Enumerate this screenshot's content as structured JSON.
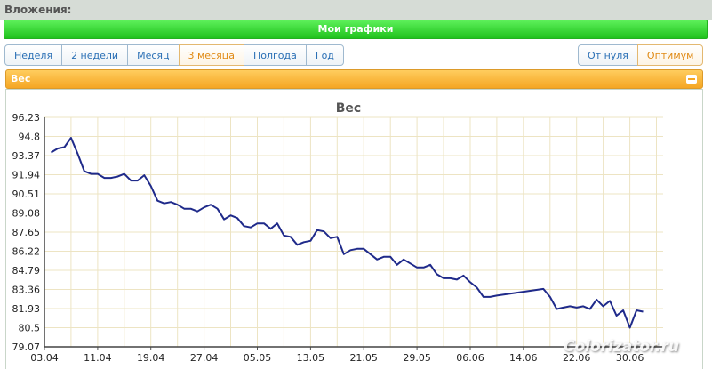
{
  "topbar": {
    "label": "Вложения:"
  },
  "panel": {
    "title": "Мои графики"
  },
  "periods": [
    "Неделя",
    "2 недели",
    "Месяц",
    "3 месяца",
    "Полгода",
    "Год"
  ],
  "period_active": "3 месяца",
  "modes": [
    "От нуля",
    "Оптимум"
  ],
  "mode_active": "Оптимум",
  "chart_header": {
    "title": "Вес"
  },
  "watermark": "Colorizator.ru",
  "colors": {
    "line": "#1f2a8a",
    "grid": "#ede4c3",
    "accent": "#f5a623",
    "brand": "#22c21f"
  },
  "chart_data": {
    "type": "line",
    "title": "Вес",
    "xlabel": "",
    "ylabel": "",
    "y_ticks": [
      "79.07",
      "80.5",
      "81.93",
      "83.36",
      "84.79",
      "86.22",
      "87.65",
      "89.08",
      "90.51",
      "91.94",
      "93.37",
      "94.8",
      "96.23"
    ],
    "ylim": [
      79.07,
      96.23
    ],
    "x_ticks": [
      "03.04",
      "11.04",
      "19.04",
      "27.04",
      "05.05",
      "13.05",
      "21.05",
      "29.05",
      "06.06",
      "14.06",
      "22.06",
      "30.06"
    ],
    "x_tick_days": [
      0,
      8,
      16,
      24,
      32,
      40,
      48,
      56,
      64,
      72,
      80,
      88
    ],
    "grid": true,
    "series": [
      {
        "name": "",
        "days": [
          1,
          2,
          3,
          4,
          5,
          6,
          7,
          8,
          9,
          10,
          11,
          12,
          13,
          14,
          15,
          16,
          17,
          18,
          19,
          20,
          21,
          22,
          23,
          24,
          25,
          26,
          27,
          28,
          29,
          30,
          31,
          32,
          33,
          34,
          35,
          36,
          37,
          38,
          39,
          40,
          41,
          42,
          43,
          44,
          45,
          46,
          47,
          48,
          49,
          50,
          51,
          52,
          53,
          54,
          55,
          56,
          57,
          58,
          59,
          60,
          61,
          62,
          63,
          64,
          65,
          66,
          67,
          68,
          75,
          76,
          77,
          78,
          79,
          80,
          81,
          82,
          83,
          84,
          85,
          86,
          87,
          88,
          89,
          90
        ],
        "values": [
          93.6,
          93.9,
          94.0,
          94.7,
          93.5,
          92.2,
          92.0,
          92.0,
          91.7,
          91.7,
          91.8,
          92.0,
          91.5,
          91.5,
          91.9,
          91.1,
          90.0,
          89.8,
          89.9,
          89.7,
          89.4,
          89.4,
          89.2,
          89.5,
          89.7,
          89.4,
          88.6,
          88.9,
          88.7,
          88.1,
          88.0,
          88.3,
          88.3,
          87.9,
          88.3,
          87.4,
          87.3,
          86.7,
          86.9,
          87.0,
          87.8,
          87.7,
          87.2,
          87.3,
          86.0,
          86.3,
          86.4,
          86.4,
          86.0,
          85.6,
          85.8,
          85.8,
          85.2,
          85.6,
          85.3,
          85.0,
          85.0,
          85.2,
          84.5,
          84.2,
          84.2,
          84.1,
          84.4,
          83.9,
          83.5,
          82.8,
          82.8,
          82.9,
          83.4,
          82.8,
          81.9,
          82.0,
          82.1,
          82.0,
          82.1,
          81.9,
          82.6,
          82.1,
          82.5,
          81.4,
          81.8,
          80.5,
          81.8,
          81.7,
          81.3,
          81.6
        ]
      }
    ]
  }
}
